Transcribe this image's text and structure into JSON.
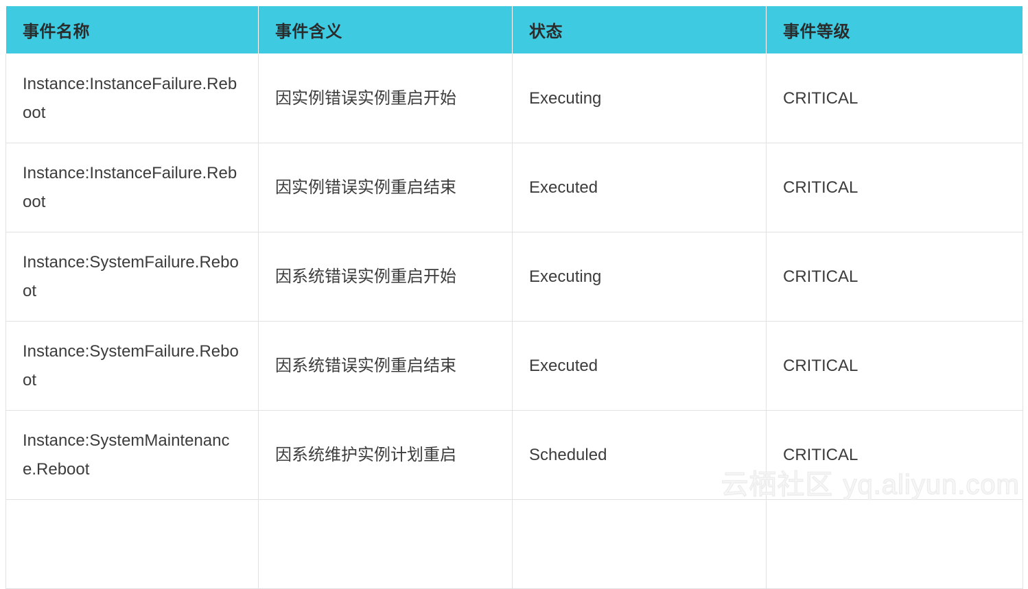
{
  "table": {
    "columns": [
      {
        "key": "name",
        "label": "事件名称"
      },
      {
        "key": "meaning",
        "label": "事件含义"
      },
      {
        "key": "status",
        "label": "状态"
      },
      {
        "key": "level",
        "label": "事件等级"
      }
    ],
    "header_background": "#3ecbe2",
    "header_text_color": "#2b2b2b",
    "body_text_color": "#3c3c3c",
    "border_color": "#e0e1e2",
    "rows": [
      {
        "name": "Instance:InstanceFailure.Reboot",
        "meaning": "因实例错误实例重启开始",
        "status": "Executing",
        "level": "CRITICAL"
      },
      {
        "name": "Instance:InstanceFailure.Reboot",
        "meaning": "因实例错误实例重启结束",
        "status": "Executed",
        "level": "CRITICAL"
      },
      {
        "name": "Instance:SystemFailure.Reboot",
        "meaning": "因系统错误实例重启开始",
        "status": "Executing",
        "level": "CRITICAL"
      },
      {
        "name": "Instance:SystemFailure.Reboot",
        "meaning": "因系统错误实例重启结束",
        "status": "Executed",
        "level": "CRITICAL"
      },
      {
        "name": "Instance:SystemMaintenance.Reboot",
        "meaning": "因系统维护实例计划重启",
        "status": "Scheduled",
        "level": "CRITICAL"
      },
      {
        "name": "",
        "meaning": "",
        "status": "",
        "level": ""
      }
    ]
  },
  "watermark": {
    "cn_text": "云栖社区",
    "url_text": "yq.aliyun.com",
    "color": "#eceded"
  }
}
